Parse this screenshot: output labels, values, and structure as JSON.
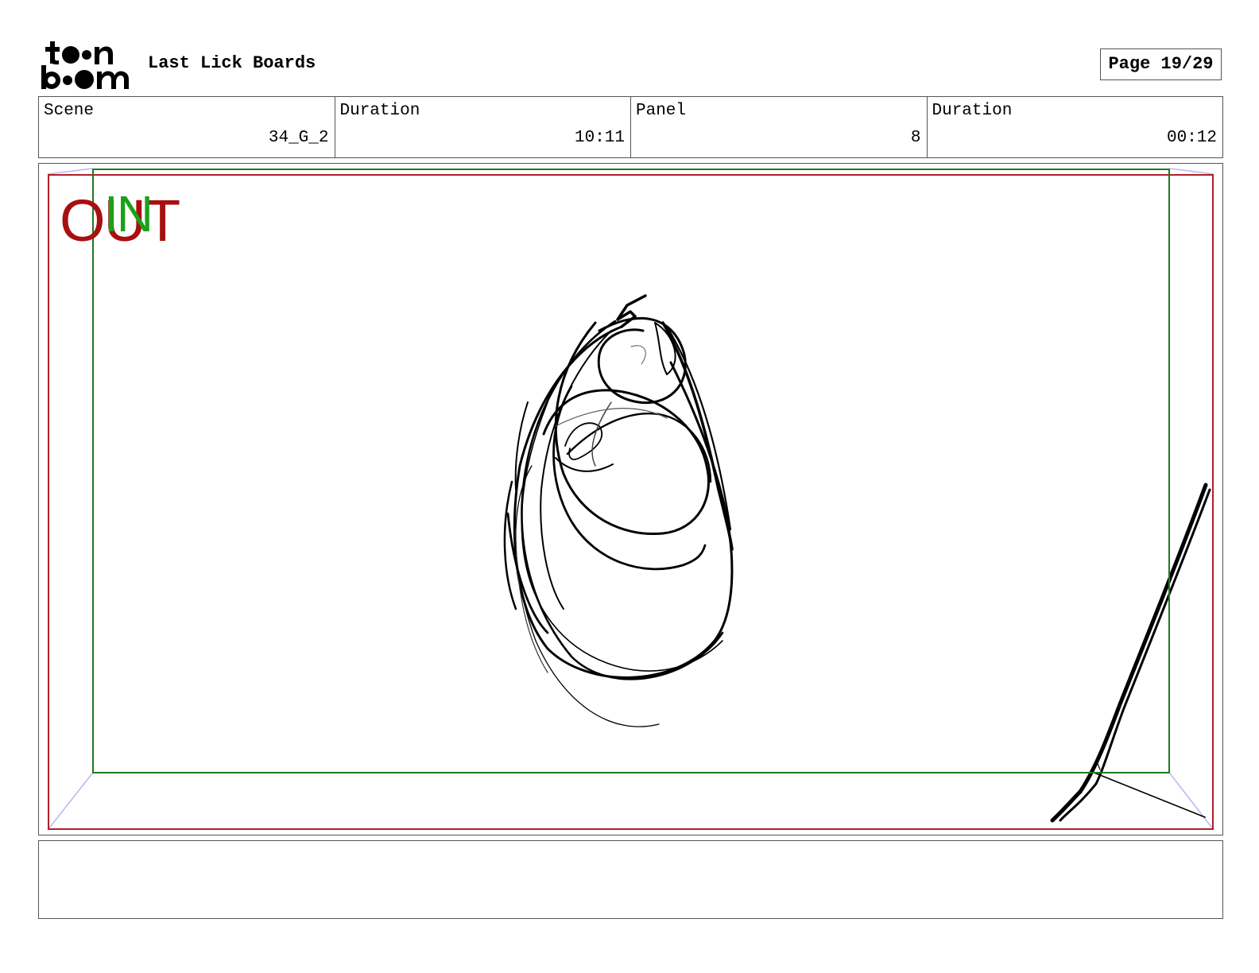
{
  "header": {
    "logo_text": "toon boom",
    "project_title": "Last Lick Boards",
    "page_label": "Page 19/29"
  },
  "info": {
    "scene_label": "Scene",
    "scene_value": "34_G_2",
    "scene_duration_label": "Duration",
    "scene_duration_value": "10:11",
    "panel_label": "Panel",
    "panel_value": "8",
    "panel_duration_label": "Duration",
    "panel_duration_value": "00:12"
  },
  "panel": {
    "out_label": "OUT",
    "in_label": "IN",
    "colors": {
      "out_frame": "#b0202a",
      "in_frame": "#1f7a1f",
      "out_text": "#a81010",
      "in_text": "#1aa11a",
      "perspective_lines": "#b9b6f0"
    }
  },
  "notes": {
    "text": ""
  }
}
